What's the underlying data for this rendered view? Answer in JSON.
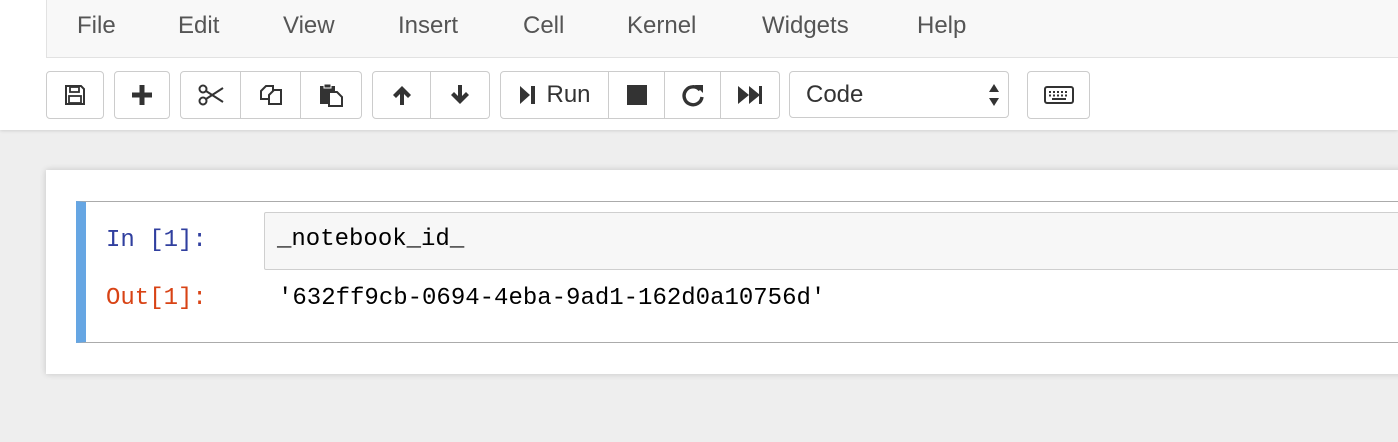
{
  "menu": {
    "items": [
      "File",
      "Edit",
      "View",
      "Insert",
      "Cell",
      "Kernel",
      "Widgets",
      "Help"
    ]
  },
  "toolbar": {
    "run_label": "Run",
    "cell_type": {
      "selected": "Code"
    },
    "icons": {
      "save": "floppy-disk-icon",
      "insert": "plus-icon",
      "cut": "scissors-icon",
      "copy": "copy-icon",
      "paste": "paste-icon",
      "move_up": "arrow-up-icon",
      "move_down": "arrow-down-icon",
      "run": "step-forward-icon",
      "interrupt": "stop-icon",
      "restart": "refresh-icon",
      "run_all": "fast-forward-icon",
      "command_palette": "keyboard-icon"
    }
  },
  "cell": {
    "in_prompt": "In [1]:",
    "code": "_notebook_id_",
    "out_prompt": "Out[1]:",
    "output": "'632ff9cb-0694-4eba-9ad1-162d0a10756d'"
  },
  "colors": {
    "selected_cell_border": "#66a6e3",
    "in_prompt": "#303f9f",
    "out_prompt": "#d84315",
    "page_background": "#eeeeee"
  }
}
